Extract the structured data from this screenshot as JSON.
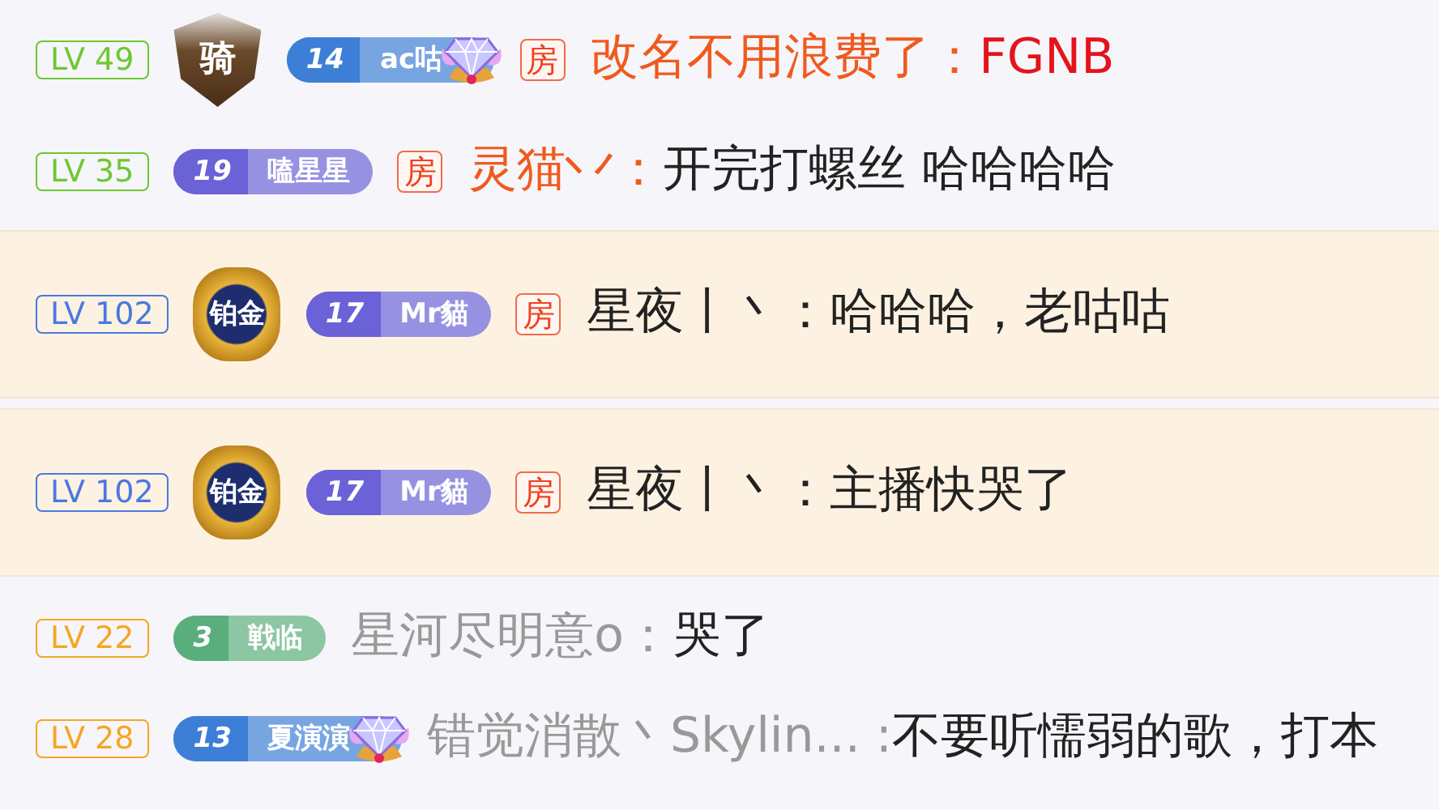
{
  "messages": [
    {
      "level": {
        "text": "LV 49",
        "color": "#6cc832"
      },
      "rank_badge": {
        "kind": "knight",
        "text": "骑"
      },
      "medal": {
        "number": "14",
        "name": "ac咕",
        "color": "#3d7fd6",
        "diamond": true
      },
      "room_tag": "房",
      "name": {
        "text": "改名不用浪费了：",
        "color": "#f05a1e"
      },
      "message": {
        "text": "FGNB",
        "color": "#e3141c"
      },
      "highlighted": false
    },
    {
      "level": {
        "text": "LV 35",
        "color": "#6cc832"
      },
      "medal": {
        "number": "19",
        "name": "嗑星星",
        "color": "#6a62d6",
        "diamond": false
      },
      "room_tag": "房",
      "name": {
        "text": "灵猫丷：",
        "color": "#f05a1e"
      },
      "message": {
        "text": "开完打螺丝 哈哈哈哈",
        "color": "#222222"
      },
      "highlighted": false
    },
    {
      "level": {
        "text": "LV 102",
        "color": "#4a78e0"
      },
      "rank_badge": {
        "kind": "platinum",
        "text": "铂金"
      },
      "medal": {
        "number": "17",
        "name": "Mr貓",
        "color": "#6a62d6",
        "diamond": false
      },
      "room_tag": "房",
      "name": {
        "text": "星夜丨丶：",
        "color": "#222222"
      },
      "message": {
        "text": "哈哈哈，老咕咕",
        "color": "#222222"
      },
      "highlighted": true
    },
    {
      "level": {
        "text": "LV 102",
        "color": "#4a78e0"
      },
      "rank_badge": {
        "kind": "platinum",
        "text": "铂金"
      },
      "medal": {
        "number": "17",
        "name": "Mr貓",
        "color": "#6a62d6",
        "diamond": false
      },
      "room_tag": "房",
      "name": {
        "text": "星夜丨丶：",
        "color": "#222222"
      },
      "message": {
        "text": "主播快哭了",
        "color": "#222222"
      },
      "highlighted": true
    },
    {
      "level": {
        "text": "LV 22",
        "color": "#f5a623"
      },
      "medal": {
        "number": "3",
        "name": "戦临",
        "color": "#5aae7c",
        "diamond": false
      },
      "name": {
        "text": "星河尽明意o：",
        "color": "#999999"
      },
      "message": {
        "text": "哭了",
        "color": "#222222"
      },
      "highlighted": false
    },
    {
      "level": {
        "text": "LV 28",
        "color": "#f5a623"
      },
      "medal": {
        "number": "13",
        "name": "夏演演",
        "color": "#3d7fd6",
        "diamond": true
      },
      "name": {
        "text": "错觉消散丶Skylin... :",
        "color": "#999999"
      },
      "message": {
        "text": "不要听懦弱的歌，打本",
        "color": "#222222"
      },
      "highlighted": false
    }
  ]
}
